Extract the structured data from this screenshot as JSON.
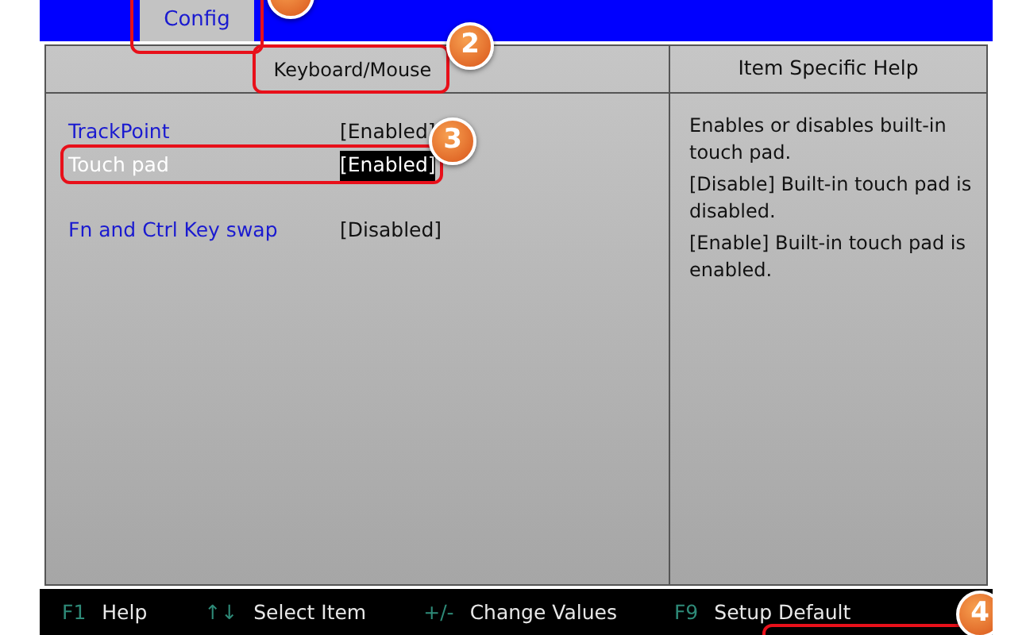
{
  "tabs": [
    {
      "label": "Config",
      "selected": true
    }
  ],
  "section_title": "Keyboard/Mouse",
  "help_title": "Item Specific Help",
  "settings": [
    {
      "label": "TrackPoint",
      "value": "[Enabled]",
      "selected": false
    },
    {
      "label": "Touch pad",
      "value": "[Enabled]",
      "selected": true
    },
    {
      "label": "Fn and Ctrl Key swap",
      "value": "[Disabled]",
      "selected": false,
      "gap_before": true
    }
  ],
  "help_text": [
    "Enables or disables built-in touch pad.",
    "[Disable] Built-in touch pad is disabled.",
    "[Enable] Built-in touch pad is enabled."
  ],
  "key_hints": [
    {
      "key": "F1",
      "action": "Help"
    },
    {
      "key": "↑↓",
      "action": "Select Item"
    },
    {
      "key": "+/-",
      "action": "Change Values"
    },
    {
      "key": "F9",
      "action": "Setup Default"
    }
  ],
  "annotations": [
    {
      "kind": "callout"
    },
    {
      "kind": "callout",
      "label": "2"
    },
    {
      "kind": "callout",
      "label": "3"
    },
    {
      "kind": "callout",
      "label": "4"
    }
  ]
}
